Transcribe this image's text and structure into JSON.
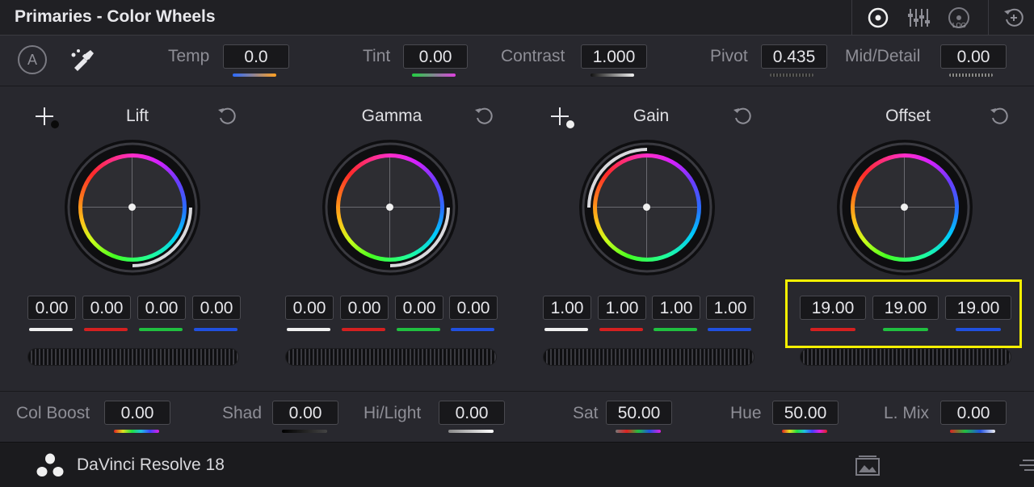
{
  "window": {
    "title": "Primaries - Color Wheels"
  },
  "titlebar_tools": [
    {
      "icon": "color-wheels-icon"
    },
    {
      "icon": "primaries-bars-icon"
    },
    {
      "icon": "log-wheels-icon",
      "label": "LOG"
    },
    {
      "icon": "reset-all-icon"
    }
  ],
  "toolbar": {
    "auto_label": "A",
    "temp": {
      "label": "Temp",
      "value": "0.0"
    },
    "tint": {
      "label": "Tint",
      "value": "0.00"
    },
    "contrast": {
      "label": "Contrast",
      "value": "1.000"
    },
    "pivot": {
      "label": "Pivot",
      "value": "0.435"
    },
    "mid_detail": {
      "label": "Mid/Detail",
      "value": "0.00"
    }
  },
  "wheels": [
    {
      "name": "Lift",
      "values": [
        "0.00",
        "0.00",
        "0.00",
        "0.00"
      ]
    },
    {
      "name": "Gamma",
      "values": [
        "0.00",
        "0.00",
        "0.00",
        "0.00"
      ]
    },
    {
      "name": "Gain",
      "values": [
        "1.00",
        "1.00",
        "1.00",
        "1.00"
      ]
    },
    {
      "name": "Offset",
      "values": [
        "19.00",
        "19.00",
        "19.00"
      ]
    }
  ],
  "bottom": {
    "col_boost": {
      "label": "Col Boost",
      "value": "0.00"
    },
    "shad": {
      "label": "Shad",
      "value": "0.00"
    },
    "hi_light": {
      "label": "Hi/Light",
      "value": "0.00"
    },
    "sat": {
      "label": "Sat",
      "value": "50.00"
    },
    "hue": {
      "label": "Hue",
      "value": "50.00"
    },
    "l_mix": {
      "label": "L. Mix",
      "value": "0.00"
    }
  },
  "footer": {
    "app_name": "DaVinci Resolve 18"
  },
  "colors": {
    "highlight": "#f5f000",
    "red_channel": "#d42020",
    "green_channel": "#20c040",
    "blue_channel": "#2050e0",
    "white_channel": "#f0f0f0"
  }
}
